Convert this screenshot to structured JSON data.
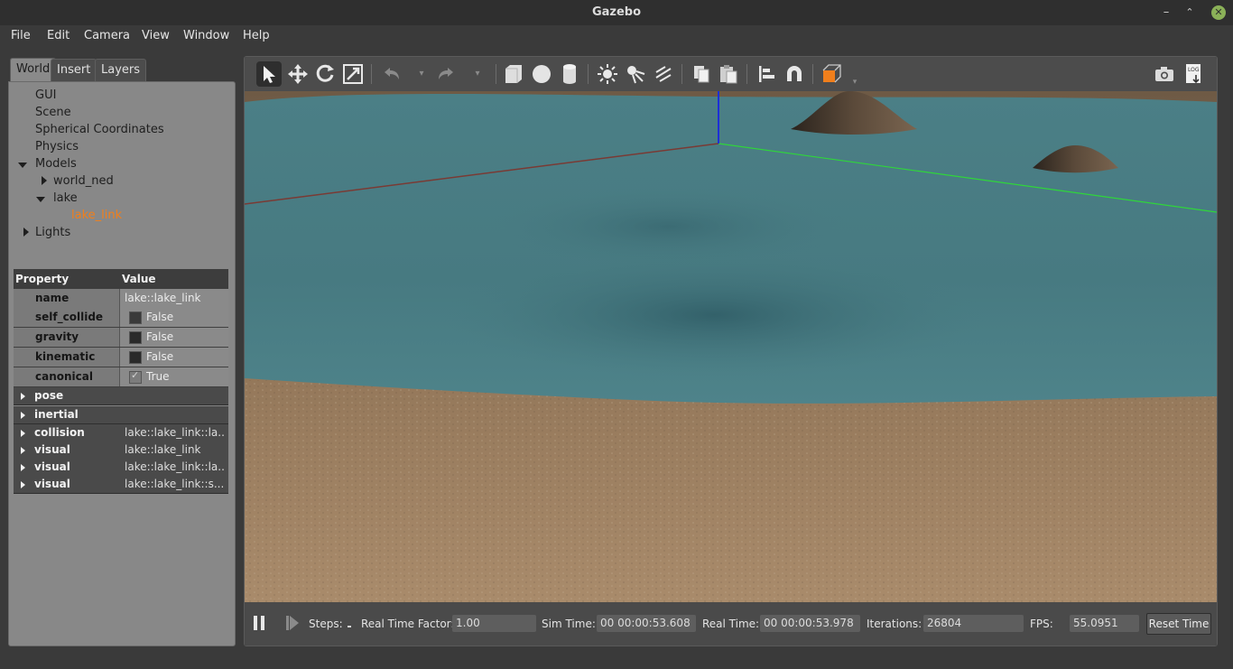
{
  "window": {
    "title": "Gazebo"
  },
  "menu": [
    "File",
    "Edit",
    "Camera",
    "View",
    "Window",
    "Help"
  ],
  "tabs": [
    "World",
    "Insert",
    "Layers"
  ],
  "tree": {
    "gui": "GUI",
    "scene": "Scene",
    "spherical": "Spherical Coordinates",
    "physics": "Physics",
    "models": "Models",
    "world_ned": "world_ned",
    "lake": "lake",
    "lake_link": "lake_link",
    "lights": "Lights"
  },
  "props": {
    "header_property": "Property",
    "header_value": "Value",
    "rows": [
      {
        "name": "name",
        "value": "lake::lake_link"
      },
      {
        "name": "self_collide",
        "value": "False",
        "checked": false
      },
      {
        "name": "gravity",
        "value": "False",
        "checked": false
      },
      {
        "name": "kinematic",
        "value": "False",
        "checked": false
      },
      {
        "name": "canonical",
        "value": "True",
        "checked": true
      }
    ],
    "groups": [
      {
        "name": "pose",
        "value": ""
      },
      {
        "name": "inertial",
        "value": ""
      },
      {
        "name": "collision",
        "value": "lake::lake_link::la..."
      },
      {
        "name": "visual",
        "value": "lake::lake_link"
      },
      {
        "name": "visual",
        "value": "lake::lake_link::la..."
      },
      {
        "name": "visual",
        "value": "lake::lake_link::s..."
      }
    ]
  },
  "status": {
    "steps_label": "Steps:",
    "rtf_label": "Real Time Factor:",
    "rtf": "1.00",
    "sim_label": "Sim Time:",
    "sim_time": "00 00:00:53.608",
    "real_label": "Real Time:",
    "real_time": "00 00:00:53.978",
    "iter_label": "Iterations:",
    "iterations": "26804",
    "fps_label": "FPS:",
    "fps": "55.0951",
    "reset_label": "Reset Time"
  },
  "colors": {
    "selected": "#f07f1c",
    "water": "#4a7b82",
    "sand": "#9a7d5f"
  }
}
